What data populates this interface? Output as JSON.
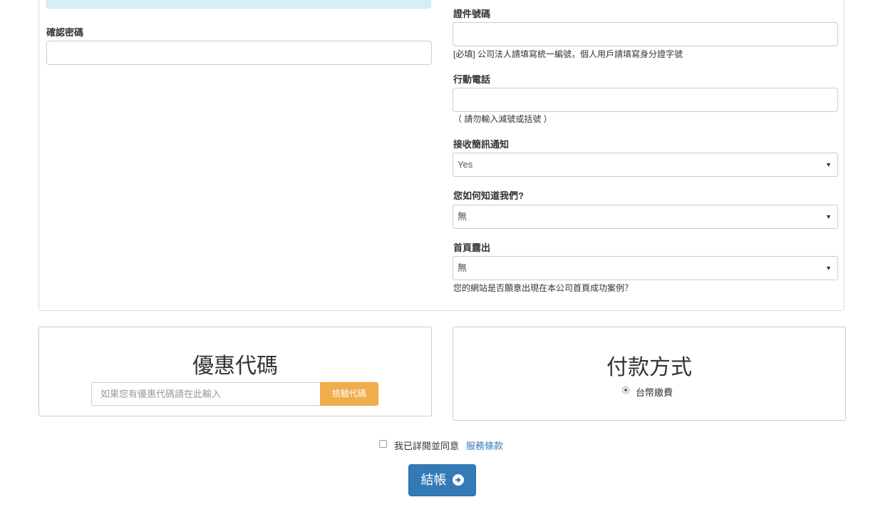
{
  "form": {
    "confirm_password_label": "確認密碼",
    "id_number_label": "證件號碼",
    "id_number_help": "[必填] 公司法人請填寫統一編號，個人用戶請填寫身分證字號",
    "mobile_label": "行動電話",
    "mobile_help": "（ 請勿輸入減號或括號 ）",
    "sms_label": "接收簡訊通知",
    "sms_value": "Yes",
    "referral_label": "您如何知道我們?",
    "referral_value": "無",
    "homepage_label": "首頁露出",
    "homepage_value": "無",
    "homepage_help": "您的網站是否願意出現在本公司首頁成功案例？"
  },
  "coupon": {
    "title": "優惠代碼",
    "placeholder": "如果您有優惠代碼請在此輸入",
    "button_label": "檢驗代碼"
  },
  "payment": {
    "title": "付款方式",
    "option_label": "台幣繳費"
  },
  "terms": {
    "text": "我已詳閱並同意",
    "link_label": "服務條款"
  },
  "checkout": {
    "label": "結帳"
  },
  "colors": {
    "primary": "#337ab7",
    "warning": "#f0ad4e",
    "info_bg": "#d9edf7"
  }
}
